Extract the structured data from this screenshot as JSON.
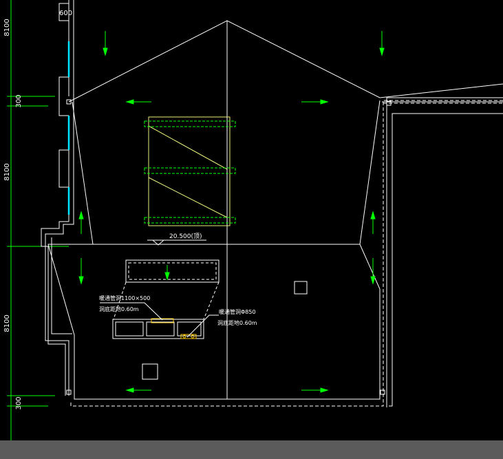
{
  "dimensions": {
    "d600": "600",
    "d8100_top": "8100",
    "d300_top": "300",
    "d8100_mid": "8100",
    "d8100_bot": "8100",
    "d300_bot": "300"
  },
  "annotations": {
    "elevation": "20.500(顶)",
    "vent_size": "暖通管洞1100×500",
    "vent_height": "洞底距地0.60m",
    "pipe_size": "暖通管洞Φ850",
    "pipe_height": "洞底距地0.60m"
  },
  "colors": {
    "background": "#000000",
    "line": "#ffffff",
    "arrow": "#00ff00",
    "glass": "#00e5ff",
    "grid": "#00ff00",
    "frame": "#e8f07a",
    "opening": "#ffcc00",
    "statusbar": "#5b5b5b"
  }
}
